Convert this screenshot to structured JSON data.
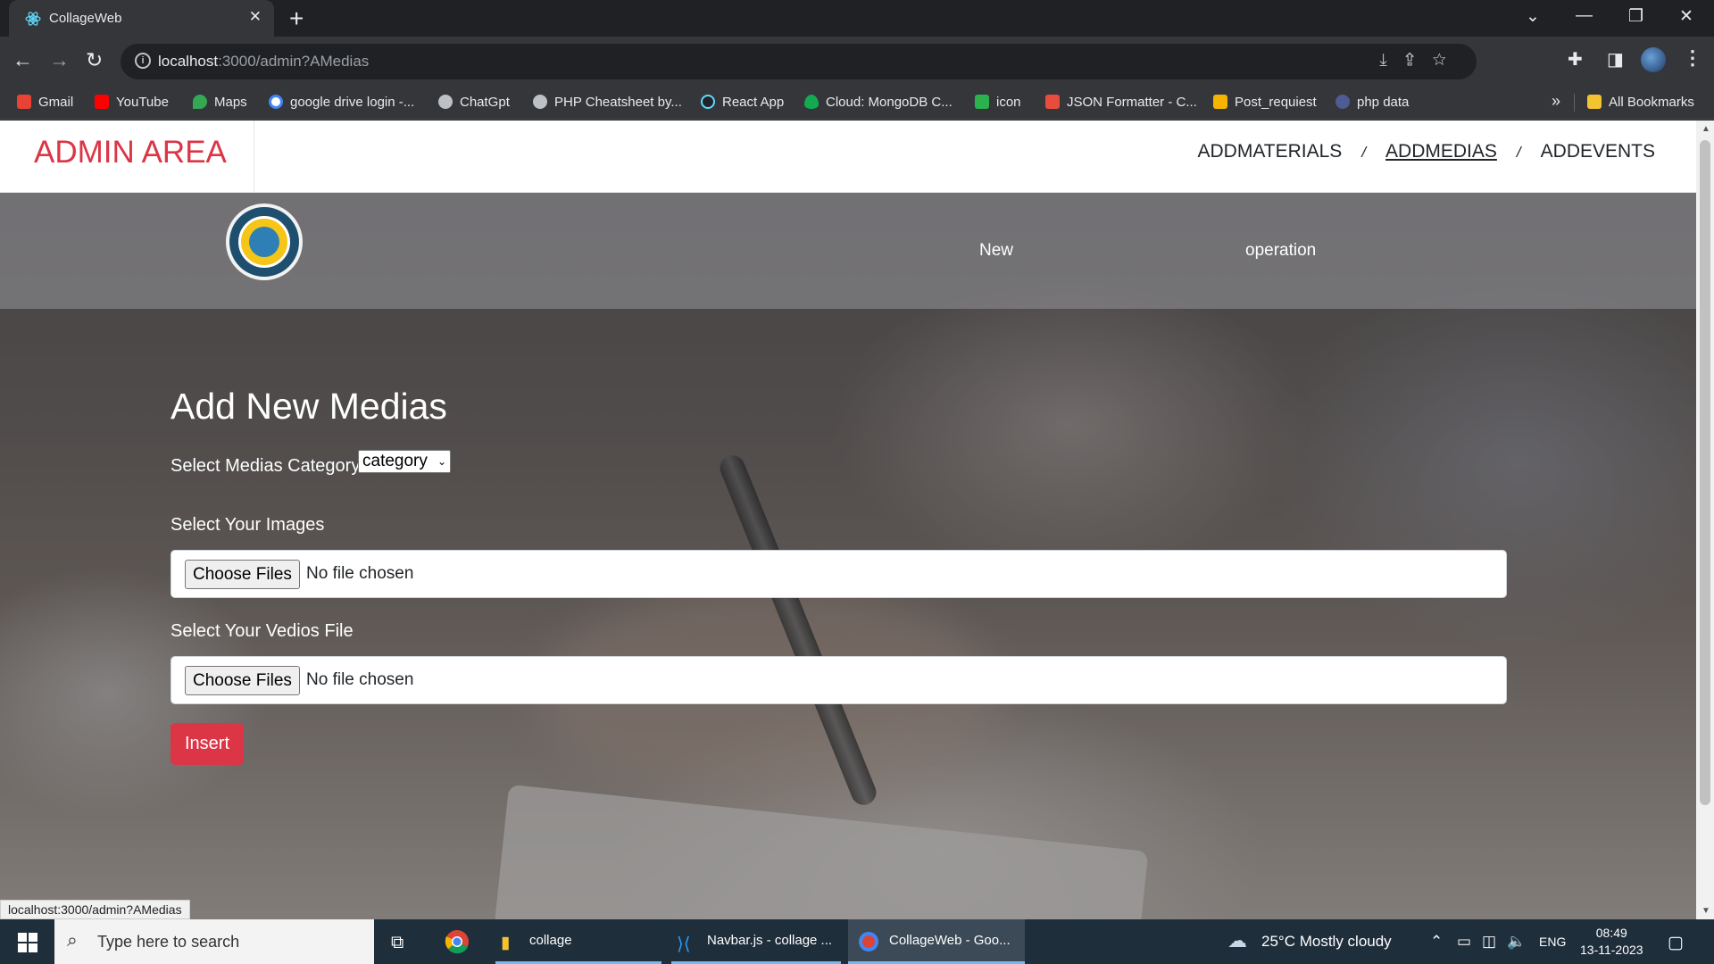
{
  "browser": {
    "tab_title": "CollageWeb",
    "url_host": "localhost",
    "url_rest": ":3000/admin?AMedias",
    "bookmarks": [
      {
        "label": "Gmail",
        "color": "#ea4335"
      },
      {
        "label": "YouTube",
        "color": "#ff0000"
      },
      {
        "label": "Maps",
        "color": "#34a853"
      },
      {
        "label": "google drive login -...",
        "color": "#4285f4"
      },
      {
        "label": "ChatGpt",
        "color": "#bdc1c6"
      },
      {
        "label": "PHP Cheatsheet by...",
        "color": "#bdc1c6"
      },
      {
        "label": "React App",
        "color": "#61dafb"
      },
      {
        "label": "Cloud: MongoDB C...",
        "color": "#13aa52"
      },
      {
        "label": "icon",
        "color": "#2bb24c"
      },
      {
        "label": "JSON Formatter - C...",
        "color": "#e84c3d"
      },
      {
        "label": "Post_requiest",
        "color": "#f4b400"
      },
      {
        "label": "php data",
        "color": "#4f5b93"
      }
    ],
    "all_bookmarks": "All Bookmarks",
    "status_url": "localhost:3000/admin?AMedias"
  },
  "admin": {
    "brand": "ADMIN AREA",
    "nav": [
      "ADDMATERIALS",
      "ADDMEDIAS",
      "ADDEVENTS"
    ],
    "active_nav": "ADDMEDIAS"
  },
  "subnav": {
    "links": [
      "New",
      "operation"
    ]
  },
  "form": {
    "title": "Add New Medias",
    "category_label": "Select Medias Category",
    "category_value": "category",
    "images_label": "Select Your Images",
    "videos_label": "Select Your Vedios File",
    "choose_files": "Choose Files",
    "no_file": "No file chosen",
    "insert": "Insert"
  },
  "taskbar": {
    "search_placeholder": "Type here to search",
    "apps": [
      "collage",
      "Navbar.js - collage ...",
      "CollageWeb - Goo..."
    ],
    "weather": "25°C  Mostly cloudy",
    "lang": "ENG",
    "time": "08:49",
    "date": "13-11-2023"
  },
  "colors": {
    "accent": "#dc3545",
    "chrome_dark": "#202124",
    "chrome_toolbar": "#35363a"
  }
}
